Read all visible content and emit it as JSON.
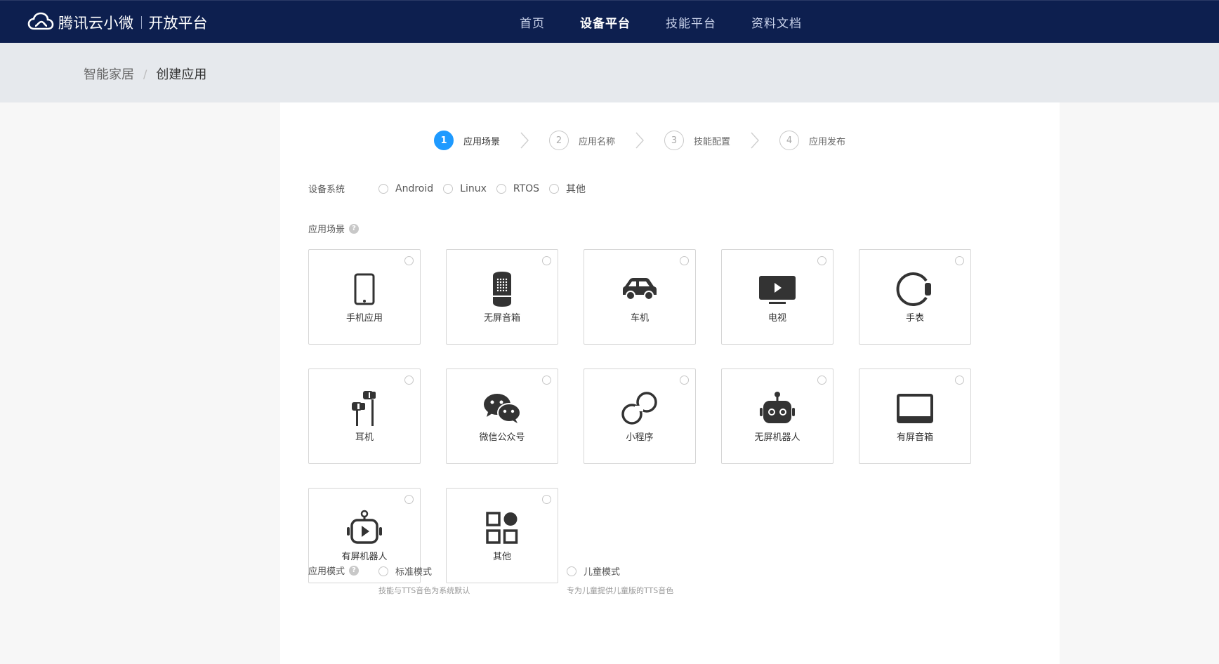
{
  "header": {
    "brand_name": "腾讯云小微",
    "brand_sub": "开放平台",
    "nav": [
      {
        "label": "首页",
        "active": false
      },
      {
        "label": "设备平台",
        "active": true
      },
      {
        "label": "技能平台",
        "active": false
      },
      {
        "label": "资料文档",
        "active": false
      }
    ]
  },
  "breadcrumb": {
    "parent": "智能家居",
    "separator": "/",
    "current": "创建应用"
  },
  "steps": [
    {
      "num": "1",
      "label": "应用场景",
      "active": true
    },
    {
      "num": "2",
      "label": "应用名称",
      "active": false
    },
    {
      "num": "3",
      "label": "技能配置",
      "active": false
    },
    {
      "num": "4",
      "label": "应用发布",
      "active": false
    }
  ],
  "device_system": {
    "label": "设备系统",
    "options": [
      "Android",
      "Linux",
      "RTOS",
      "其他"
    ]
  },
  "scene": {
    "label": "应用场景",
    "help": "?",
    "cards": [
      {
        "label": "手机应用",
        "icon": "phone-icon"
      },
      {
        "label": "无屏音箱",
        "icon": "speaker-icon"
      },
      {
        "label": "车机",
        "icon": "car-icon"
      },
      {
        "label": "电视",
        "icon": "tv-icon"
      },
      {
        "label": "手表",
        "icon": "watch-icon"
      },
      {
        "label": "耳机",
        "icon": "earphone-icon"
      },
      {
        "label": "微信公众号",
        "icon": "wechat-icon"
      },
      {
        "label": "小程序",
        "icon": "mini-program-icon"
      },
      {
        "label": "无屏机器人",
        "icon": "robot-icon"
      },
      {
        "label": "有屏音箱",
        "icon": "screen-speaker-icon"
      },
      {
        "label": "有屏机器人",
        "icon": "screen-robot-icon"
      },
      {
        "label": "其他",
        "icon": "apps-icon"
      }
    ]
  },
  "mode": {
    "label": "应用模式",
    "help": "?",
    "options": [
      {
        "label": "标准模式",
        "desc": "技能与TTS音色为系统默认"
      },
      {
        "label": "儿童模式",
        "desc": "专为儿童提供儿童版的TTS音色"
      }
    ]
  },
  "colors": {
    "header_bg": "#0d1f4f",
    "accent": "#1e9aff",
    "icon": "#333333"
  }
}
